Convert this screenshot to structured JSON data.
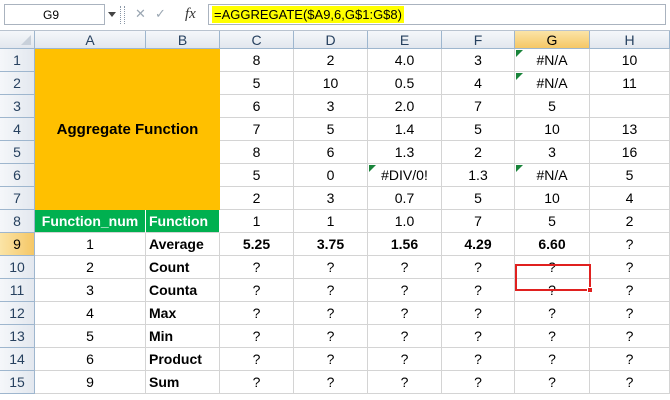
{
  "formula_bar": {
    "cell_ref": "G9",
    "formula": "=AGGREGATE($A9,6,G$1:G$8)",
    "fx_label": "fx",
    "cancel_glyph": "✕",
    "enter_glyph": "✓"
  },
  "columns": [
    "A",
    "B",
    "C",
    "D",
    "E",
    "F",
    "G",
    "H"
  ],
  "rows": [
    "1",
    "2",
    "3",
    "4",
    "5",
    "6",
    "7",
    "8",
    "9",
    "10",
    "11",
    "12",
    "13",
    "14",
    "15"
  ],
  "sheet": {
    "title": "Aggregate Function",
    "header_a": "Function_num",
    "header_b": "Function",
    "data": [
      [
        "8",
        "2",
        "4.0",
        "3",
        "#N/A",
        "10"
      ],
      [
        "5",
        "10",
        "0.5",
        "4",
        "#N/A",
        "11"
      ],
      [
        "6",
        "3",
        "2.0",
        "7",
        "5",
        ""
      ],
      [
        "7",
        "5",
        "1.4",
        "5",
        "10",
        "13"
      ],
      [
        "8",
        "6",
        "1.3",
        "2",
        "3",
        "16"
      ],
      [
        "5",
        "0",
        "#DIV/0!",
        "1.3",
        "#N/A",
        "5"
      ],
      [
        "2",
        "3",
        "0.7",
        "5",
        "10",
        "4"
      ],
      [
        "1",
        "1",
        "1.0",
        "7",
        "5",
        "2"
      ]
    ],
    "functions": [
      {
        "num": "1",
        "name": "Average",
        "values": [
          "5.25",
          "3.75",
          "1.56",
          "4.29",
          "6.60",
          "?"
        ]
      },
      {
        "num": "2",
        "name": "Count",
        "values": [
          "?",
          "?",
          "?",
          "?",
          "?",
          "?"
        ]
      },
      {
        "num": "3",
        "name": "Counta",
        "values": [
          "?",
          "?",
          "?",
          "?",
          "?",
          "?"
        ]
      },
      {
        "num": "4",
        "name": "Max",
        "values": [
          "?",
          "?",
          "?",
          "?",
          "?",
          "?"
        ]
      },
      {
        "num": "5",
        "name": "Min",
        "values": [
          "?",
          "?",
          "?",
          "?",
          "?",
          "?"
        ]
      },
      {
        "num": "6",
        "name": "Product",
        "values": [
          "?",
          "?",
          "?",
          "?",
          "?",
          "?"
        ]
      },
      {
        "num": "9",
        "name": "Sum",
        "values": [
          "?",
          "?",
          "?",
          "?",
          "?",
          "?"
        ]
      }
    ]
  },
  "colors": {
    "title_fill": "#ffc000",
    "header_fill": "#00b050",
    "selection_border": "#e0201f",
    "formula_highlight": "#ffff00",
    "error_marker": "#19843a"
  }
}
